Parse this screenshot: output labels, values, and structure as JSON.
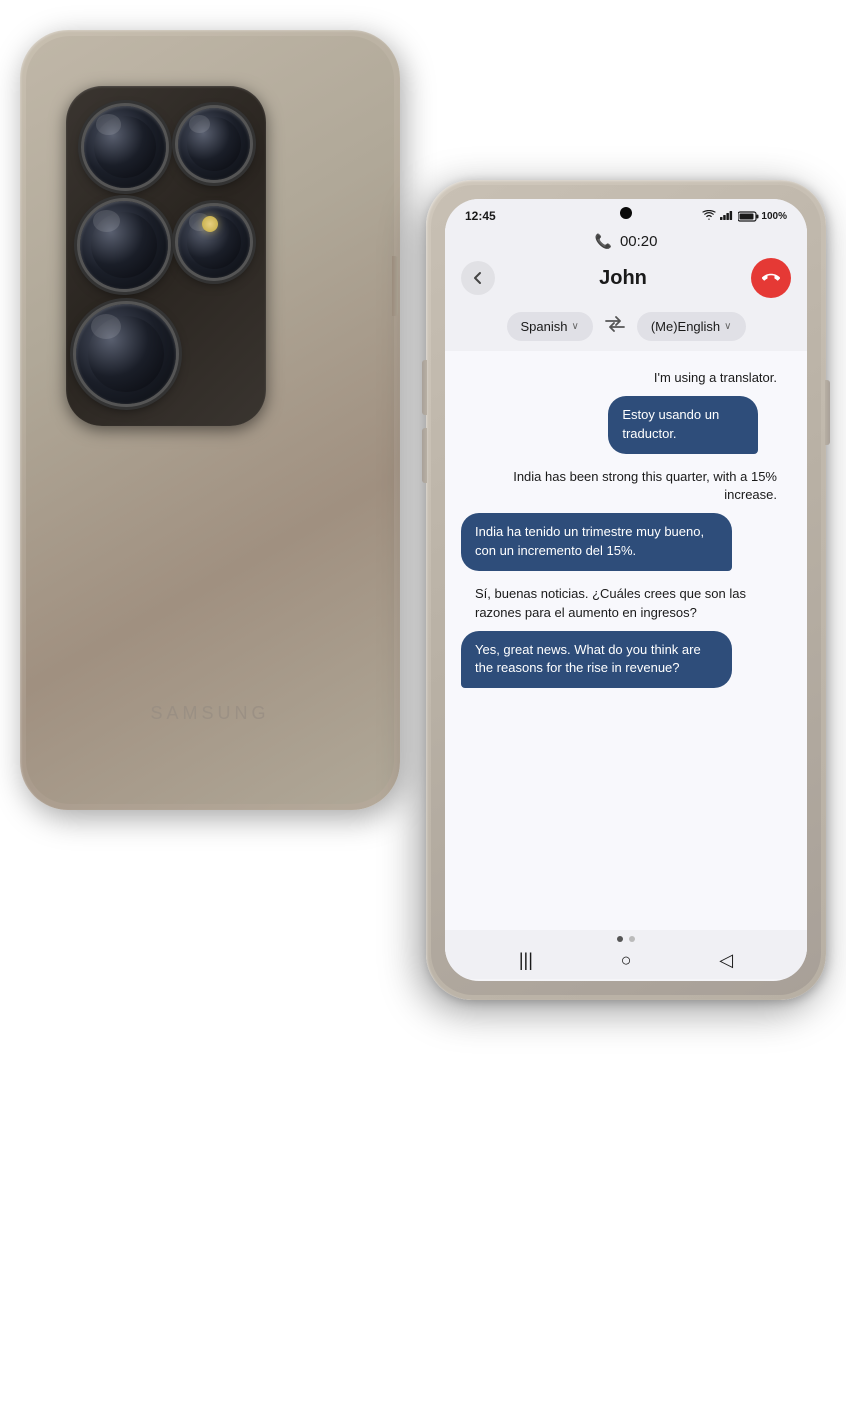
{
  "back_phone": {
    "brand": "SAMSUNG",
    "cameras": [
      {
        "id": "lens-1",
        "size": "large-top-left"
      },
      {
        "id": "lens-2",
        "size": "medium-top-right"
      },
      {
        "id": "lens-3",
        "size": "large-mid-left"
      },
      {
        "id": "lens-4",
        "size": "medium-mid-right"
      },
      {
        "id": "lens-5",
        "size": "xlarge-bottom"
      }
    ]
  },
  "front_phone": {
    "status_bar": {
      "time": "12:45",
      "wifi": "WiFi",
      "signal": "Signal",
      "battery": "100%"
    },
    "call": {
      "timer": "00:20",
      "contact_name": "John"
    },
    "language_selector": {
      "source_lang": "Spanish",
      "source_chevron": "∨",
      "swap_icon": "⇄",
      "target_lang": "(Me)English",
      "target_chevron": "∨"
    },
    "messages": [
      {
        "id": "msg-1",
        "side": "right",
        "plain_text": "I'm using a translator.",
        "translated_text": "Estoy usando un traductor."
      },
      {
        "id": "msg-2",
        "side": "right",
        "plain_text": "India has been strong this quarter, with a 15% increase.",
        "translated_text": "India ha tenido un trimestre muy bueno, con un incremento del 15%."
      },
      {
        "id": "msg-3",
        "side": "left",
        "plain_text": "Sí, buenas noticias. ¿Cuáles crees que son las razones para el aumento en ingresos?",
        "translated_text": "Yes, great news. What do you think are the reasons for the rise in revenue?"
      }
    ],
    "navigation": {
      "page_dots": [
        {
          "active": true
        },
        {
          "active": false
        }
      ],
      "back_button": "◁",
      "home_button": "○",
      "recent_button": "|||"
    },
    "buttons": {
      "back_label": "⬅",
      "end_call_label": "📵"
    }
  }
}
